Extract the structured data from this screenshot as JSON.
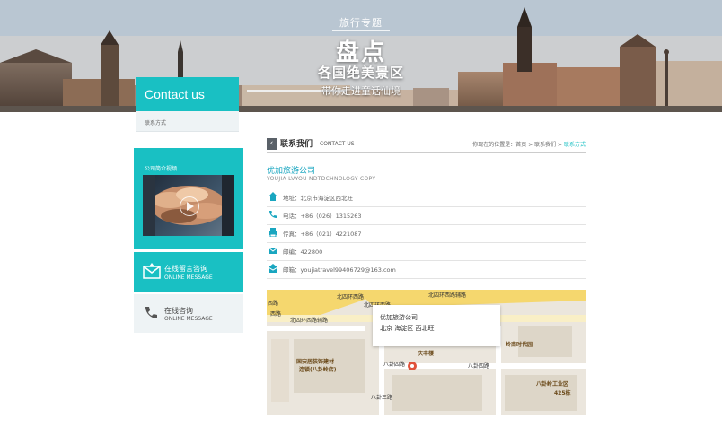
{
  "banner": {
    "subtitle": "旅行专题",
    "title": "盘点",
    "headline": "各国绝美景区",
    "tagline": "带你走进童话仙境"
  },
  "sidebar": {
    "heading": "Contact us",
    "active_item": "联系方式",
    "video_title": "公司简介视频",
    "online_message": {
      "cn": "在线留言咨询",
      "en": "ONLINE MESSAGE"
    },
    "online_consult": {
      "cn": "在线咨询",
      "en": "ONLINE MESSAGE"
    }
  },
  "content": {
    "back_icon": "chevron-left-icon",
    "section_title": "联系我们",
    "section_title_en": "CONTACT US",
    "breadcrumb_prefix": "你现在的位置是：首页 > 联系我们 > ",
    "breadcrumb_current": "联系方式",
    "company_name": "优加旅游公司",
    "company_name_en": "YOUJIA LVYOU NDTDCHNOLOGY COPY",
    "info": [
      {
        "icon": "home-icon",
        "text": "地址：北京市海淀区西北旺"
      },
      {
        "icon": "phone-icon",
        "text": "电话：+86（026）1315263"
      },
      {
        "icon": "fax-icon",
        "text": "传真：+86（021）4221087"
      },
      {
        "icon": "mail-icon",
        "text": "邮编：422800"
      },
      {
        "icon": "email-icon",
        "text": "邮箱：youjiatravel99406729@163.com"
      }
    ]
  },
  "map": {
    "popup_name": "优加旅游公司",
    "popup_address": "北京 海淀区 西北旺",
    "labels": {
      "road1": "北四环西路",
      "road2": "北四环西路",
      "road3": "北四环西路辅路",
      "road4": "北四环西路辅路",
      "road5": "西路",
      "road6": "西路",
      "bld1": "庆丰楼",
      "bld2": "岭南时代园",
      "bld3": "国安居装饰建材",
      "bld4": "连锁(八卦岭店)",
      "road7": "八卦四路",
      "road8": "八卦四路",
      "bld5": "八卦岭工业区",
      "bld6": "425栋",
      "road9": "八卦三路"
    },
    "colors": {
      "road": "#f5d76e",
      "water": "#b8d4e8",
      "bg": "#ebe6dd"
    }
  },
  "colors": {
    "accent": "#19c0c3",
    "link": "#19a6c0"
  }
}
